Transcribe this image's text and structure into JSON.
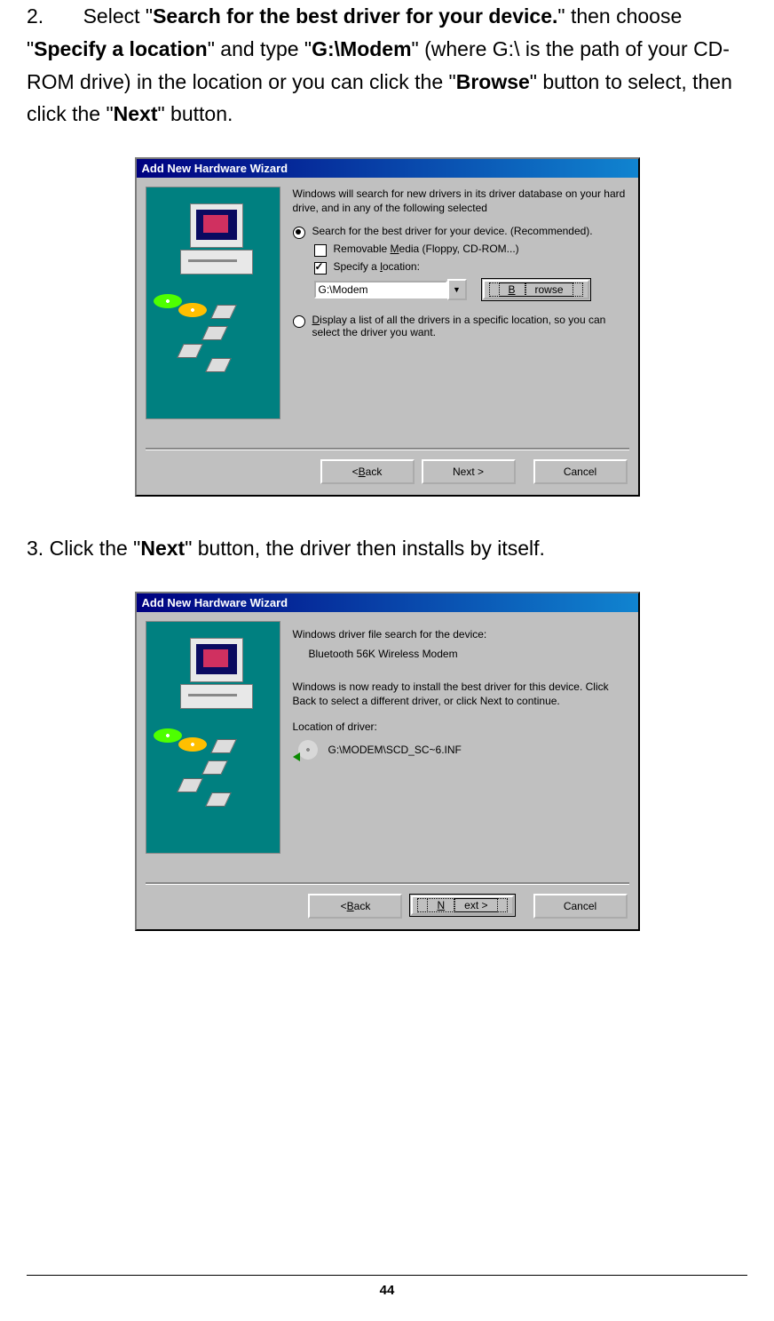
{
  "steps": {
    "s2": {
      "num": "2.",
      "pre1": "Select \"",
      "bold1": "Search for the best driver for your device.",
      "mid1": "\" then choose \"",
      "bold2": "Specify a location",
      "mid2": "\" and type \"",
      "bold3": "G:\\Modem",
      "mid3": "\" (where G:\\ is the path of your CD-ROM drive) in the location or you can click the \"",
      "bold4": "Browse",
      "mid4": "\" button to select, then click the \"",
      "bold5": "Next",
      "mid5": "\" button."
    },
    "s3": {
      "num": "3.",
      "pre1": "Click the \"",
      "bold1": "Next",
      "mid1": "\" button, the driver then installs by itself."
    }
  },
  "dialog1": {
    "title": "Add New Hardware Wizard",
    "intro": "Windows will search for new drivers in its driver database on your hard drive, and in any of the following selected",
    "opt_search": "Search for the best driver for your device. (Recommended).",
    "chk_media_pre": "Removable ",
    "chk_media_u": "M",
    "chk_media_post": "edia (Floppy, CD-ROM...)",
    "chk_loc_pre": "Specify a ",
    "chk_loc_u": "l",
    "chk_loc_post": "ocation:",
    "loc_value": "G:\\Modem",
    "browse_u": "B",
    "browse_post": "rowse",
    "opt_list_u": "D",
    "opt_list_post": "isplay a list of all the drivers in a specific location, so you can select the driver you want.",
    "back_pre": "< ",
    "back_u": "B",
    "back_post": "ack",
    "next": "Next >",
    "cancel": "Cancel"
  },
  "dialog2": {
    "title": "Add New Hardware Wizard",
    "line1": "Windows driver file search for the device:",
    "device": "Bluetooth 56K Wireless Modem",
    "line2": "Windows is now ready to install the best driver for this device. Click Back to select a different driver, or click Next to continue.",
    "loc_label": "Location of driver:",
    "loc_value": "G:\\MODEM\\SCD_SC~6.INF",
    "back_pre": "< ",
    "back_u": "B",
    "back_post": "ack",
    "next_u": "N",
    "next_post": "ext >",
    "cancel": "Cancel"
  },
  "page_number": "44"
}
